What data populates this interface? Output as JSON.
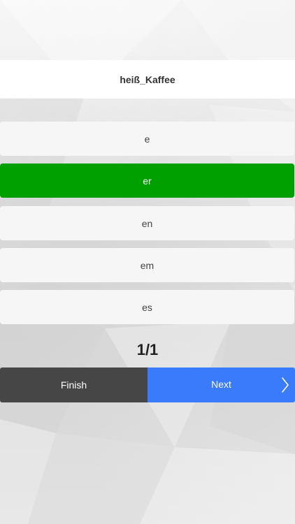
{
  "question": {
    "word": "heiß_Kaffee"
  },
  "options": [
    {
      "label": "e",
      "selected": false
    },
    {
      "label": "er",
      "selected": true
    },
    {
      "label": "en",
      "selected": false
    },
    {
      "label": "em",
      "selected": false
    },
    {
      "label": "es",
      "selected": false
    }
  ],
  "progress": {
    "text": "1/1"
  },
  "buttons": {
    "finish_label": "Finish",
    "next_label": "Next",
    "next_icon": "chevron-right-icon"
  },
  "colors": {
    "selected_option": "#00a000",
    "finish_button": "#464646",
    "next_button": "#3a7bfb"
  }
}
